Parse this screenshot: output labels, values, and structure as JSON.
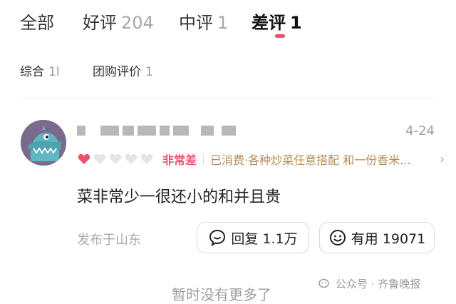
{
  "tabs": [
    {
      "label": "全部",
      "count": ""
    },
    {
      "label": "好评",
      "count": "204"
    },
    {
      "label": "中评",
      "count": "1"
    },
    {
      "label": "差评",
      "count": "1"
    }
  ],
  "active_tab": "差评",
  "filters": [
    {
      "label": "综合",
      "suffix": "1l"
    },
    {
      "label": "团购评价",
      "suffix": "1"
    }
  ],
  "review": {
    "date": "4-24",
    "rating": 1,
    "rating_max": 5,
    "rating_label": "非常差",
    "dish_text": "已消费·各种炒菜任意搭配 和一份香米...",
    "text": "菜非常少一很还小的和并且贵",
    "location": "发布于山东",
    "reply_label": "回复 1.1万",
    "useful_label": "有用 19071"
  },
  "footer": {
    "no_more": "暂时没有更多了"
  },
  "watermark": {
    "text": "公众号 · 齐鲁晚报"
  },
  "colors": {
    "accent": "#e8546d",
    "dish": "#b88a58",
    "muted": "#a0a0a0"
  }
}
